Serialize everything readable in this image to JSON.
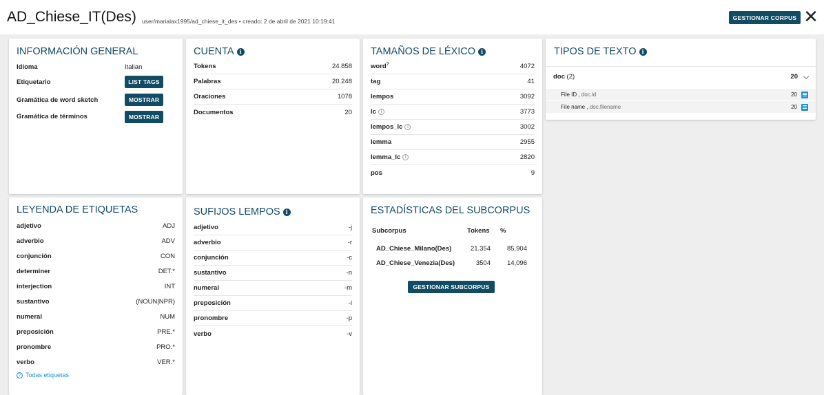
{
  "header": {
    "title": "AD_Chiese_IT(Des)",
    "subtitle": "user/marialax1995/ad_chiese_it_des • creado: 2 de abril de 2021 10:19:41",
    "manage_corpus": "GESTIONAR CORPUS",
    "close_glyph": "✕"
  },
  "general": {
    "title": "INFORMACIÓN GENERAL",
    "rows": [
      {
        "label": "Idioma",
        "value": "Italian"
      },
      {
        "label": "Etiquetario",
        "button": "LIST TAGS"
      },
      {
        "label": "Gramática de word sketch",
        "button": "MOSTRAR"
      },
      {
        "label": "Gramática de términos",
        "button": "MOSTRAR"
      }
    ]
  },
  "count": {
    "title": "CUENTA",
    "info_icon": "i",
    "rows": [
      {
        "label": "Tokens",
        "value": "24.858"
      },
      {
        "label": "Palabras",
        "value": "20.248"
      },
      {
        "label": "Oraciones",
        "value": "1078"
      },
      {
        "label": "Documentos",
        "value": "20"
      }
    ]
  },
  "lexicon": {
    "title": "TAMAÑOS DE LÉXICO",
    "info_icon": "i",
    "rows": [
      {
        "label": "word",
        "sup": "?",
        "value": "4072"
      },
      {
        "label": "tag",
        "value": "41"
      },
      {
        "label": "lempos",
        "value": "3092"
      },
      {
        "label": "lc",
        "info": "i",
        "value": "3773"
      },
      {
        "label": "lempos_lc",
        "info": "i",
        "value": "3002"
      },
      {
        "label": "lemma",
        "value": "2955"
      },
      {
        "label": "lemma_lc",
        "info": "i",
        "value": "2820"
      },
      {
        "label": "pos",
        "value": "9"
      }
    ]
  },
  "text_types": {
    "title": "TIPOS DE TEXTO",
    "info_icon": "i",
    "doc_label": "doc",
    "doc_count": "(2)",
    "doc_total": "20",
    "attrs": [
      {
        "name": "File ID ,",
        "key": "doc.id",
        "value": "20"
      },
      {
        "name": "File name ,",
        "key": "doc.filename",
        "value": "20"
      }
    ]
  },
  "tags": {
    "title": "LEYENDA DE ETIQUETAS",
    "rows": [
      {
        "label": "adjetivo",
        "value": "ADJ"
      },
      {
        "label": "adverbio",
        "value": "ADV"
      },
      {
        "label": "conjunción",
        "value": "CON"
      },
      {
        "label": "determiner",
        "value": "DET.*"
      },
      {
        "label": "interjection",
        "value": "INT"
      },
      {
        "label": "sustantivo",
        "value": "(NOUN|NPR)"
      },
      {
        "label": "numeral",
        "value": "NUM"
      },
      {
        "label": "preposición",
        "value": "PRE.*"
      },
      {
        "label": "pronombre",
        "value": "PRO.*"
      },
      {
        "label": "verbo",
        "value": "VER.*"
      }
    ],
    "all_tags_link": "Todas etiquetas",
    "help_icon": "?"
  },
  "suffixes": {
    "title": "SUFIJOS LEMPOS",
    "info_icon": "i",
    "rows": [
      {
        "label": "adjetivo",
        "value": "-j"
      },
      {
        "label": "adverbio",
        "value": "-r"
      },
      {
        "label": "conjunción",
        "value": "-c"
      },
      {
        "label": "sustantivo",
        "value": "-n"
      },
      {
        "label": "numeral",
        "value": "-m"
      },
      {
        "label": "preposición",
        "value": "-i"
      },
      {
        "label": "pronombre",
        "value": "-p"
      },
      {
        "label": "verbo",
        "value": "-v"
      }
    ]
  },
  "subcorpus": {
    "title": "ESTADÍSTICAS DEL SUBCORPUS",
    "headers": [
      "Subcorpus",
      "Tokens",
      "%"
    ],
    "rows": [
      {
        "name": "AD_Chiese_Milano(Des)",
        "tokens": "21.354",
        "pct": "85,904"
      },
      {
        "name": "AD_Chiese_Venezia(Des)",
        "tokens": "3504",
        "pct": "14,096"
      }
    ],
    "manage_button": "GESTIONAR SUBCORPUS"
  }
}
